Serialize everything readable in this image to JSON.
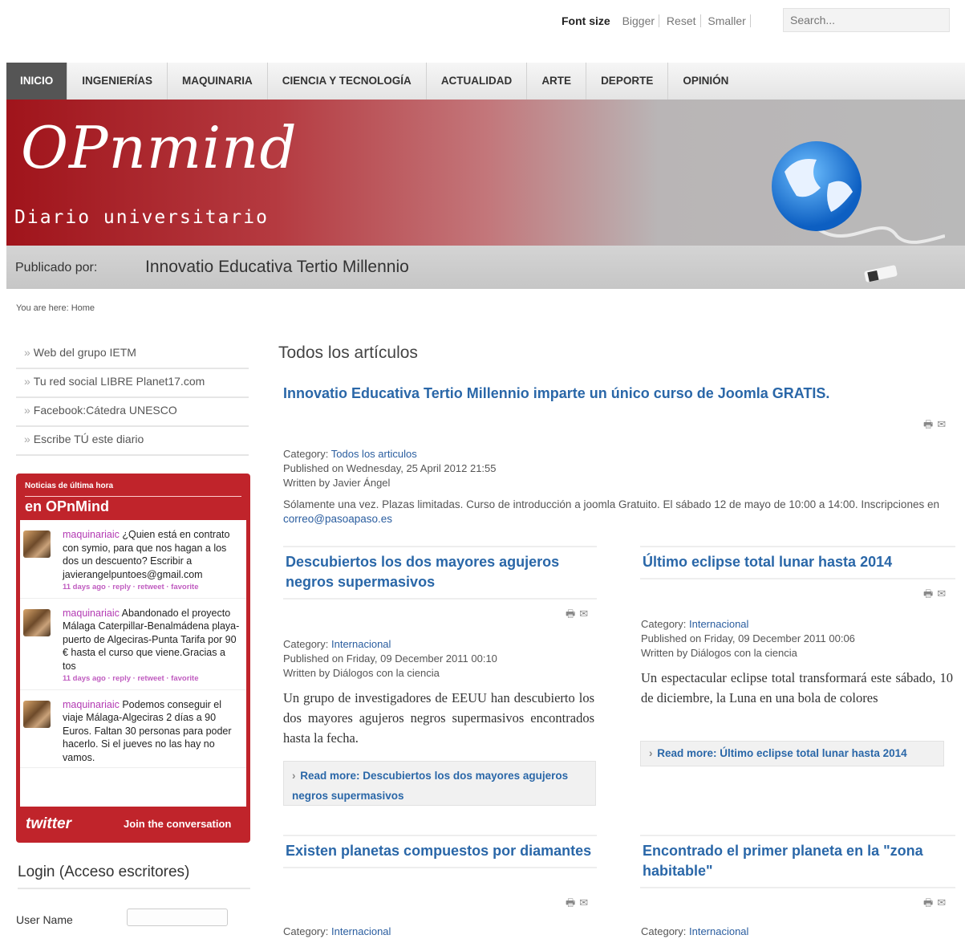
{
  "top": {
    "font_size_label": "Font size",
    "bigger": "Bigger",
    "reset": "Reset",
    "smaller": "Smaller",
    "search_placeholder": "Search..."
  },
  "nav": [
    "INICIO",
    "INGENIERÍAS",
    "MAQUINARIA",
    "CIENCIA Y TECNOLOGÍA",
    "ACTUALIDAD",
    "ARTE",
    "DEPORTE",
    "OPINIÓN"
  ],
  "banner": {
    "logo": "OPnmind",
    "tagline": "Diario universitario",
    "published_label": "Publicado por:",
    "publisher": "Innovatio Educativa Tertio Millennio"
  },
  "breadcrumb": "You are here: Home",
  "sidebar": {
    "links": [
      "Web del grupo IETM",
      "Tu red social LIBRE Planet17.com",
      "Facebook:Cátedra UNESCO",
      "Escribe TÚ este diario"
    ],
    "twitter": {
      "small": "Noticias de última hora",
      "title": "en OPnMind",
      "tweets": [
        {
          "user": "maquinariaic",
          "text": " ¿Quien está en contrato con symio, para que nos hagan a los dos un descuento? Escribir a javierangelpuntoes@gmail.com",
          "meta": "11 days ago · reply · retweet · favorite"
        },
        {
          "user": "maquinariaic",
          "text": " Abandonado el proyecto Málaga Caterpillar-Benalmádena playa-puerto de Algeciras-Punta Tarifa por 90 € hasta el curso que viene.Gracias a tos",
          "meta": "11 days ago · reply · retweet · favorite"
        },
        {
          "user": "maquinariaic",
          "text": " Podemos conseguir el viaje Málaga-Algeciras 2 días a 90 Euros. Faltan 30 personas para poder hacerlo. Si el jueves no las hay no vamos.",
          "meta": ""
        }
      ],
      "logo": "twitter",
      "join": "Join the conversation"
    },
    "login_title": "Login (Acceso escritores)",
    "user_label": "User Name"
  },
  "main": {
    "title": "Todos los artículos",
    "lead": {
      "title": "Innovatio Educativa Tertio Millennio imparte un único curso de Joomla GRATIS.",
      "category_label": "Category: ",
      "category": "Todos los articulos",
      "published": "Published on Wednesday, 25 April 2012 21:55",
      "written": "Written by Javier Ángel",
      "text": "Sólamente una vez. Plazas limitadas. Curso de introducción a joomla Gratuito. El sábado 12 de mayo de 10:00 a 14:00. Inscripciones en ",
      "email": "correo@pasoapaso.es"
    },
    "articles": [
      {
        "title": "Descubiertos los dos mayores agujeros negros supermasivos",
        "category_label": "Category: ",
        "category": "Internacional",
        "published": "Published on Friday, 09 December 2011 00:10",
        "written": "Written by Diálogos con la ciencia",
        "text": "Un grupo de investigadores de EEUU han descubierto los dos mayores agujeros negros supermasivos encontrados hasta la fecha.",
        "readmore": "Read more: Descubiertos los dos mayores agujeros negros supermasivos"
      },
      {
        "title": "Último eclipse total lunar hasta 2014",
        "category_label": "Category: ",
        "category": "Internacional",
        "published": "Published on Friday, 09 December 2011 00:06",
        "written": "Written by Diálogos con la ciencia",
        "text": "Un espectacular eclipse total transformará este sábado, 10 de diciembre, la Luna en una bola de colores",
        "readmore": "Read more: Último eclipse total lunar hasta 2014"
      },
      {
        "title": "Existen planetas compuestos por diamantes",
        "category_label": "Category: ",
        "category": "Internacional"
      },
      {
        "title": "Encontrado el primer planeta en la \"zona habitable\"",
        "category_label": "Category: ",
        "category": "Internacional"
      }
    ]
  },
  "icons": {
    "print": "🖶",
    "email": "✉"
  }
}
